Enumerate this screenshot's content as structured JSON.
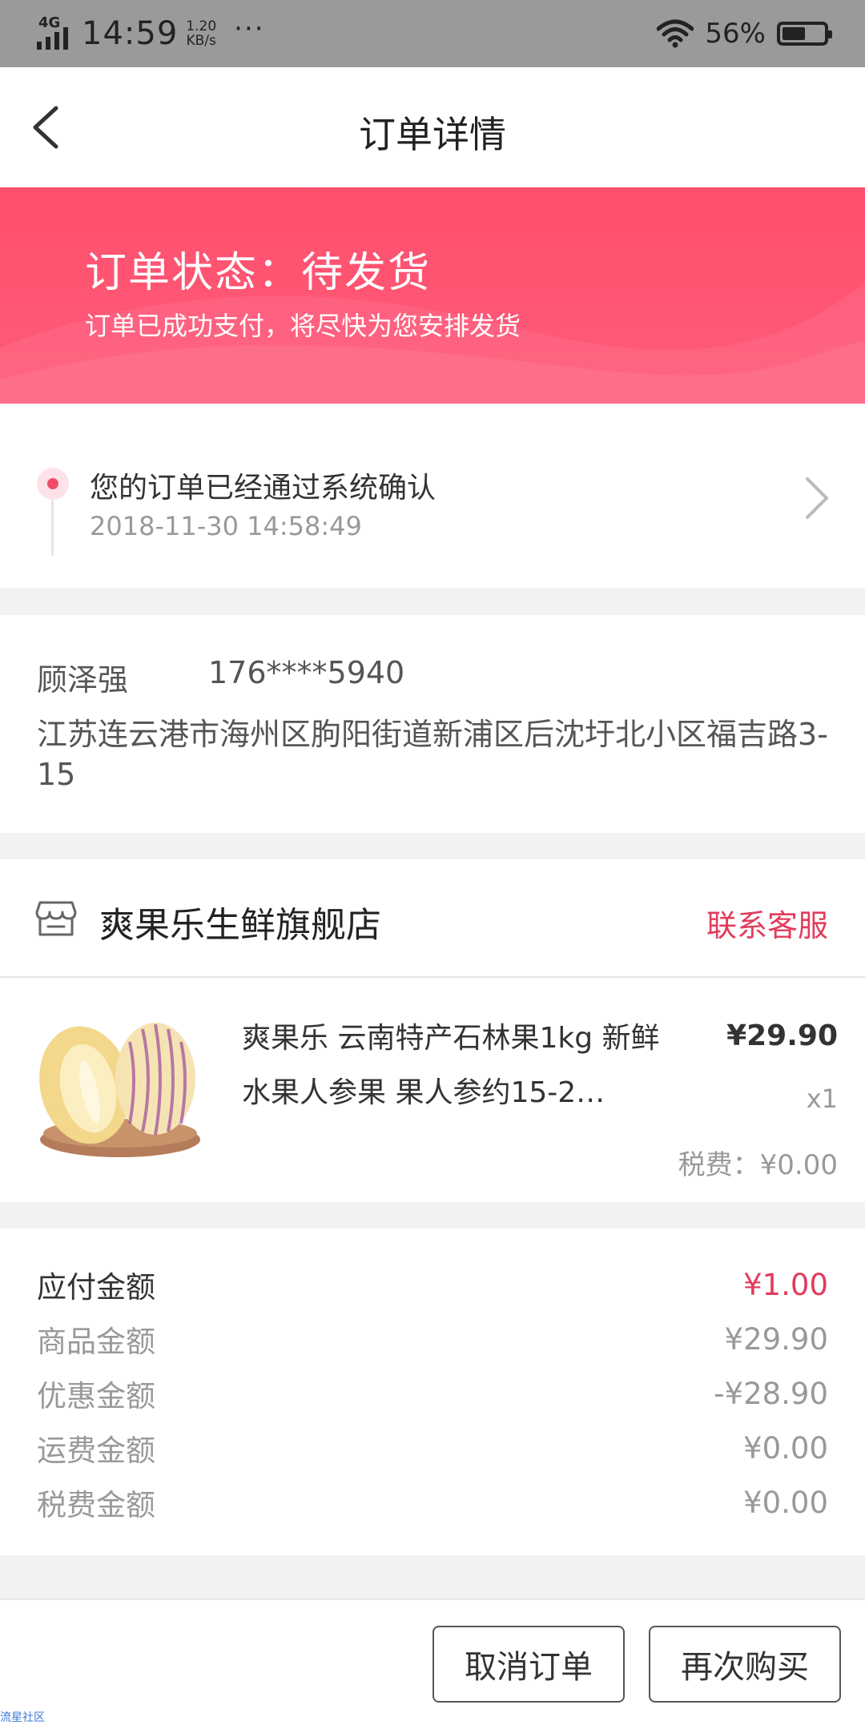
{
  "status_bar": {
    "network": "4G",
    "time": "14:59",
    "speed_value": "1.20",
    "speed_unit": "KB/s",
    "more": "···",
    "battery_pct": "56%",
    "battery_level": 0.56
  },
  "header": {
    "title": "订单详情",
    "back_icon": "chevron-left-icon"
  },
  "banner": {
    "status": "订单状态：待发货",
    "description": "订单已成功支付，将尽快为您安排发货"
  },
  "timeline": {
    "message": "您的订单已经通过系统确认",
    "time": "2018-11-30 14:58:49"
  },
  "address": {
    "name": "顾泽强",
    "phone": "176****5940",
    "text": "江苏连云港市海州区朐阳街道新浦区后沈圩北小区福吉路3-15"
  },
  "store": {
    "name": "爽果乐生鲜旗舰店",
    "contact": "联系客服",
    "product": {
      "title": "爽果乐 云南特产石林果1kg 新鲜水果人参果 果人参约15-2…",
      "price": "¥29.90",
      "qty": "x1",
      "tax": "税费：¥0.00"
    }
  },
  "summary": {
    "rows": [
      {
        "label": "应付金额",
        "value": "¥1.00"
      },
      {
        "label": "商品金额",
        "value": "¥29.90"
      },
      {
        "label": "优惠金额",
        "value": "-¥28.90"
      },
      {
        "label": "运费金额",
        "value": "¥0.00"
      },
      {
        "label": "税费金额",
        "value": "¥0.00"
      }
    ]
  },
  "actions": {
    "cancel": "取消订单",
    "rebuy": "再次购买"
  },
  "watermark": "流星社区",
  "colors": {
    "accent": "#e23c5c",
    "banner": "#fe4f6d",
    "status_bar": "#9a9a9a"
  }
}
